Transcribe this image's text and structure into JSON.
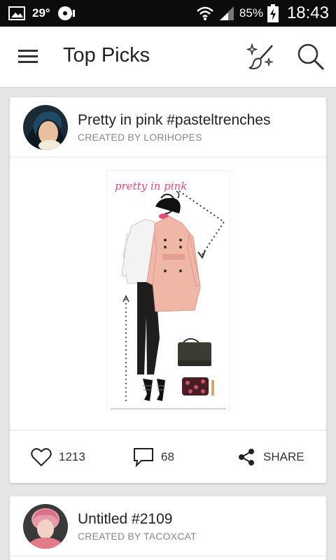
{
  "status_bar": {
    "temperature": "29°",
    "battery": "85%",
    "time": "18:43"
  },
  "header": {
    "title": "Top Picks",
    "icons": [
      "menu-icon",
      "brush-sparkle-icon",
      "search-icon"
    ]
  },
  "feed": [
    {
      "title": "Pretty in pink #pasteltrenches",
      "creator": "CREATED BY LORIHOPES",
      "image_text": "pretty in pink",
      "likes": "1213",
      "comments": "68",
      "share_label": "SHARE"
    },
    {
      "title": "Untitled #2109",
      "creator": "CREATED BY TACOXCAT"
    }
  ],
  "colors": {
    "accent_pink": "#e8497f",
    "trench_pink": "#f0b7a6",
    "status_bar_bg": "#0c0c0c",
    "page_bg": "#e6e6e6"
  }
}
